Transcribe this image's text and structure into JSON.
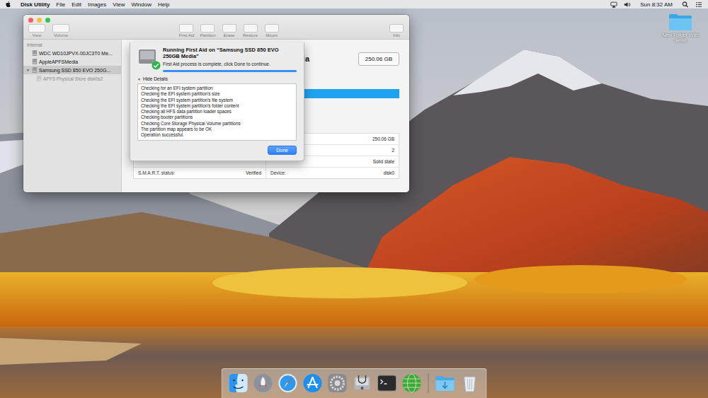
{
  "menubar": {
    "app": "Disk Utility",
    "menus": [
      "File",
      "Edit",
      "Images",
      "View",
      "Window",
      "Help"
    ],
    "clock": "Sun 8:32 AM"
  },
  "desktop_icons": [
    {
      "label": "New Folder With Items",
      "selected": false
    }
  ],
  "window": {
    "toolbar_left": [
      {
        "label": "View"
      },
      {
        "label": "Volume"
      }
    ],
    "toolbar_center": [
      {
        "label": "First Aid"
      },
      {
        "label": "Partition"
      },
      {
        "label": "Erase"
      },
      {
        "label": "Restore"
      },
      {
        "label": "Mount"
      }
    ],
    "toolbar_right": [
      {
        "label": "Info"
      }
    ],
    "sidebar": {
      "header": "Internal",
      "items": [
        {
          "label": "WDC WD10JPVX-00JC3T0 Me...",
          "kind": "disk",
          "toggle": "",
          "selected": false
        },
        {
          "label": "AppleAPFSMedia",
          "kind": "disk",
          "toggle": "",
          "selected": false
        },
        {
          "label": "Samsung SSD 850 EVO 250G...",
          "kind": "disk",
          "toggle": "▼",
          "selected": true
        },
        {
          "label": "APFS Physical Store disk0s2",
          "kind": "store",
          "toggle": "",
          "selected": false
        }
      ]
    },
    "detail": {
      "title": "edia",
      "capacity": "250.06 GB",
      "usage_level": 1,
      "info": [
        {
          "left_label": "",
          "left_value": "",
          "right_label": "",
          "right_value": "250.06 GB"
        },
        {
          "left_label": "",
          "left_value": "",
          "right_label": "",
          "right_value": "2"
        },
        {
          "left_label": "",
          "left_value": "",
          "right_label": "",
          "right_value": "Solid state"
        },
        {
          "left_label": "S.M.A.R.T. status:",
          "left_value": "Verified",
          "right_label": "Device:",
          "right_value": "disk0"
        }
      ]
    }
  },
  "first_aid": {
    "title": "Running First Aid on “Samsung SSD 850 EVO 250GB Media”",
    "message": "First Aid process is complete, click Done to continue.",
    "success": true,
    "level": 1,
    "details_toggle": "▼",
    "details_label": "Hide Details",
    "log": [
      "Checking for an EFI system partition",
      "Checking the EFI system partition's size",
      "Checking the EFI system partition's file system",
      "Checking the EFI system partition's folder content",
      "Checking all HFS data partition loader spaces",
      "Checking booter partitions",
      "Checking Core Storage Physical Volume partitions",
      "The partition map appears to be OK",
      "Operation successful."
    ],
    "button": "Done"
  }
}
